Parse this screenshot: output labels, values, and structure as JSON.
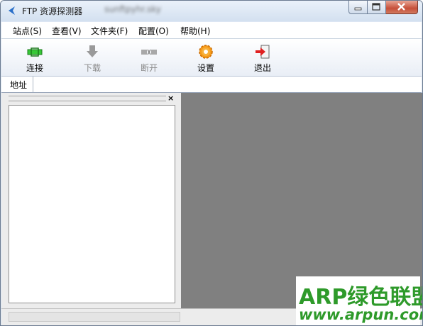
{
  "window": {
    "title": "FTP 资源探测器",
    "blurred_text": "sunftpyhr.sky"
  },
  "menu": [
    {
      "label": "站点(S)"
    },
    {
      "label": "查看(V)"
    },
    {
      "label": "文件夹(F)"
    },
    {
      "label": "配置(O)"
    },
    {
      "label": "帮助(H)"
    }
  ],
  "toolbar": {
    "connect": {
      "label": "连接",
      "icon": "connect-icon",
      "enabled": true
    },
    "download": {
      "label": "下载",
      "icon": "download-icon",
      "enabled": false
    },
    "disconnect": {
      "label": "断开",
      "icon": "disconnect-icon",
      "enabled": false
    },
    "settings": {
      "label": "设置",
      "icon": "gear-icon",
      "enabled": true
    },
    "exit": {
      "label": "退出",
      "icon": "exit-icon",
      "enabled": true
    }
  },
  "address": {
    "label": "地址",
    "value": ""
  },
  "left_pane": {
    "close_glyph": "×"
  },
  "watermark": {
    "line1": "ARP绿色联盟",
    "line2": "www.arpun.com"
  },
  "colors": {
    "content_bg": "#808080",
    "watermark": "#2e9a2a",
    "close_button": "#c6503a"
  }
}
